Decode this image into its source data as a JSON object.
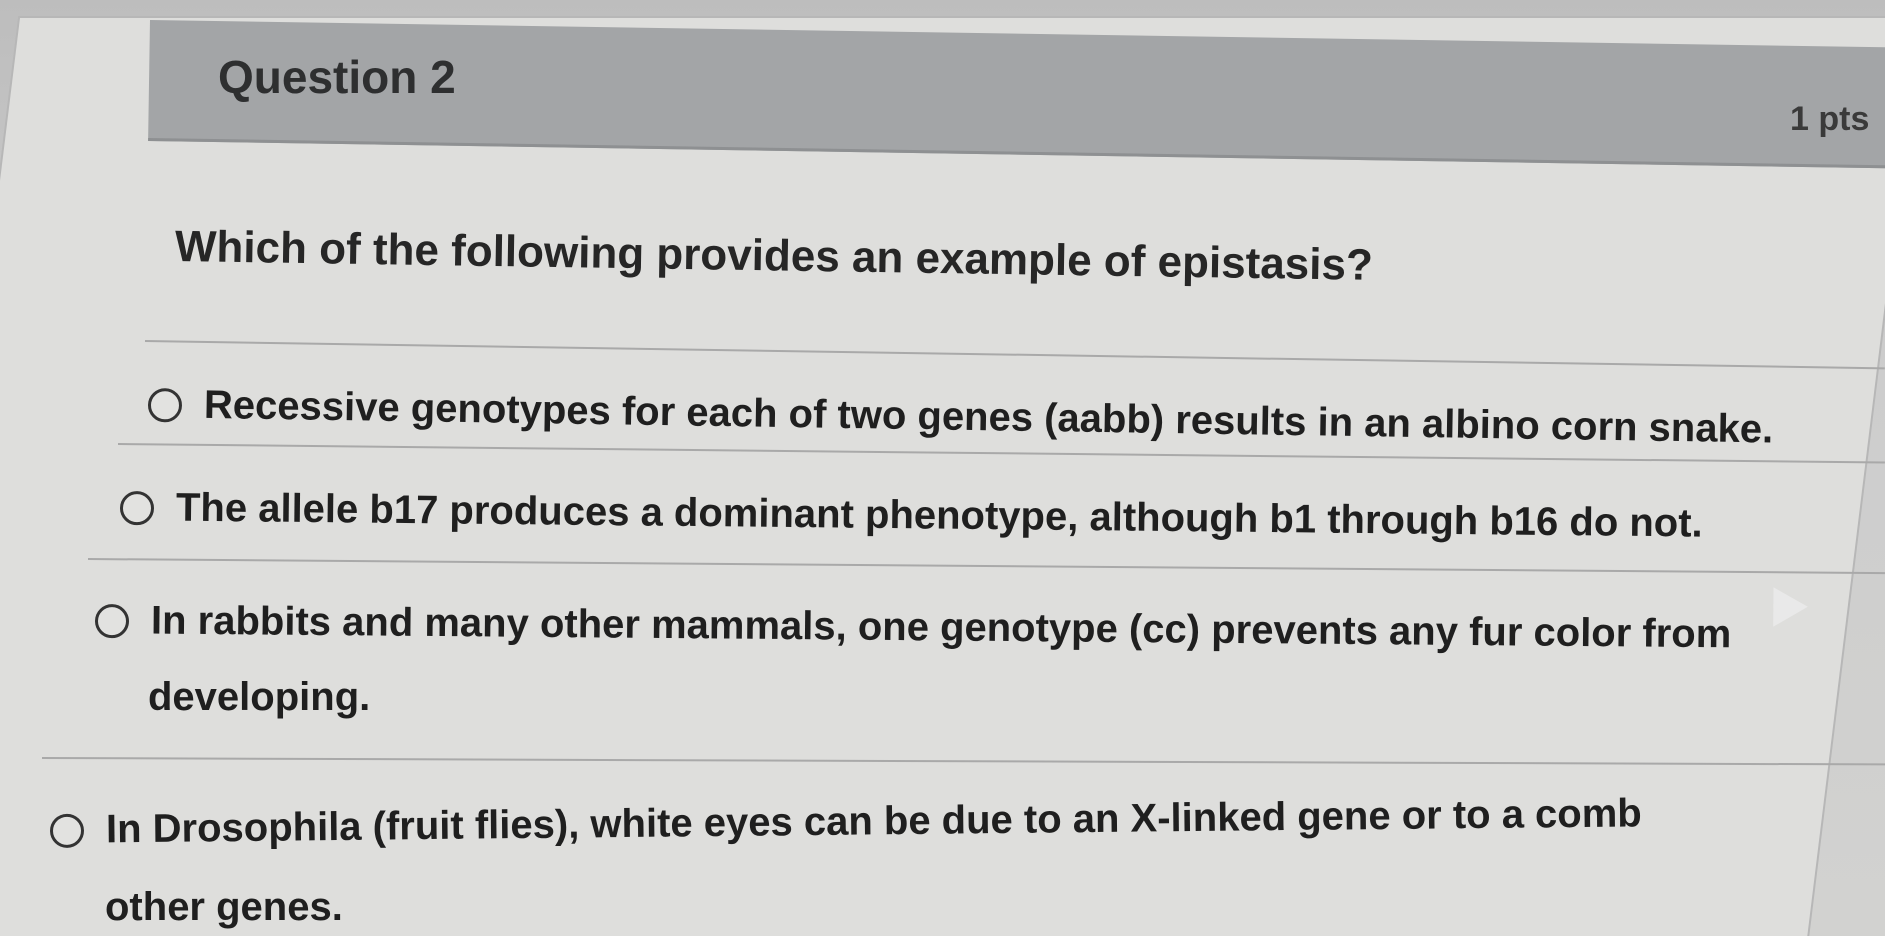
{
  "question": {
    "title": "Question 2",
    "points": "1 pts",
    "prompt": "Which of the following provides an example of epistasis?"
  },
  "answers": [
    {
      "line1": "Recessive genotypes for each of two genes (aabb) results in an albino corn snake.",
      "line2": ""
    },
    {
      "line1": "The allele b17 produces a dominant phenotype, although b1 through b16 do not.",
      "line2": ""
    },
    {
      "line1": "In rabbits and many other mammals, one genotype (cc) prevents any fur color from",
      "line2": "developing."
    },
    {
      "line1": "In Drosophila (fruit flies), white eyes can be due to an X-linked gene or to a comb",
      "line2": "other genes."
    }
  ]
}
